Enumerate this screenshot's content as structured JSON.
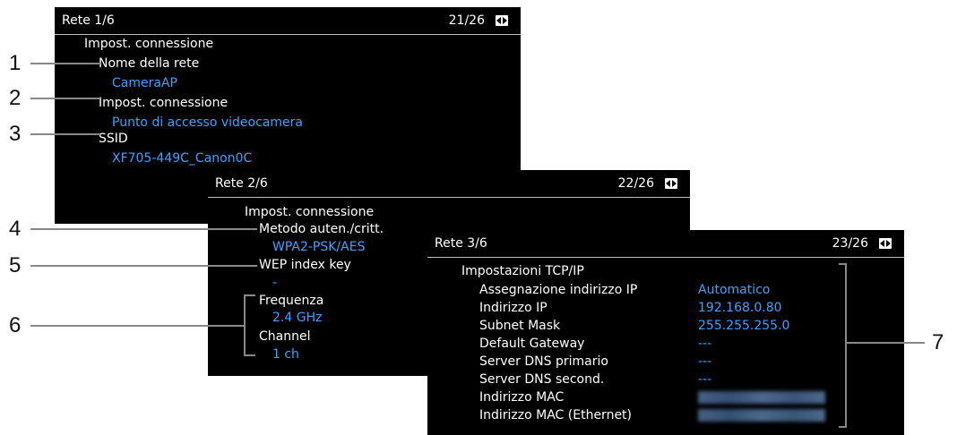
{
  "screen1": {
    "title": "Rete 1/6",
    "page": "21/26",
    "lines": [
      "Impost. connessione",
      "Nome della rete",
      "CameraAP",
      "Impost. connessione",
      "Punto di accesso videocamera",
      "SSID",
      "XF705-449C_Canon0C"
    ]
  },
  "screen2": {
    "title": "Rete 2/6",
    "page": "22/26",
    "lines": [
      "Impost. connessione",
      "Metodo auten./critt.",
      "WPA2-PSK/AES",
      "WEP index key",
      "-",
      "Frequenza",
      "2.4 GHz",
      "Channel",
      "1 ch"
    ]
  },
  "screen3": {
    "title": "Rete 3/6",
    "page": "23/26",
    "heading": "Impostazioni TCP/IP",
    "rows": [
      {
        "label": "Assegnazione indirizzo IP",
        "value": "Automatico"
      },
      {
        "label": "Indirizzo IP",
        "value": "192.168.0.80"
      },
      {
        "label": "Subnet Mask",
        "value": "255.255.255.0"
      },
      {
        "label": "Default Gateway",
        "value": "---"
      },
      {
        "label": "Server DNS primario",
        "value": "---"
      },
      {
        "label": "Server DNS second.",
        "value": "---"
      },
      {
        "label": "Indirizzo MAC",
        "value": ""
      },
      {
        "label": "Indirizzo MAC (Ethernet)",
        "value": ""
      }
    ]
  },
  "callouts": [
    "1",
    "2",
    "3",
    "4",
    "5",
    "6",
    "7"
  ],
  "colors": {
    "value": "#3ea2ff",
    "background": "#000000"
  }
}
